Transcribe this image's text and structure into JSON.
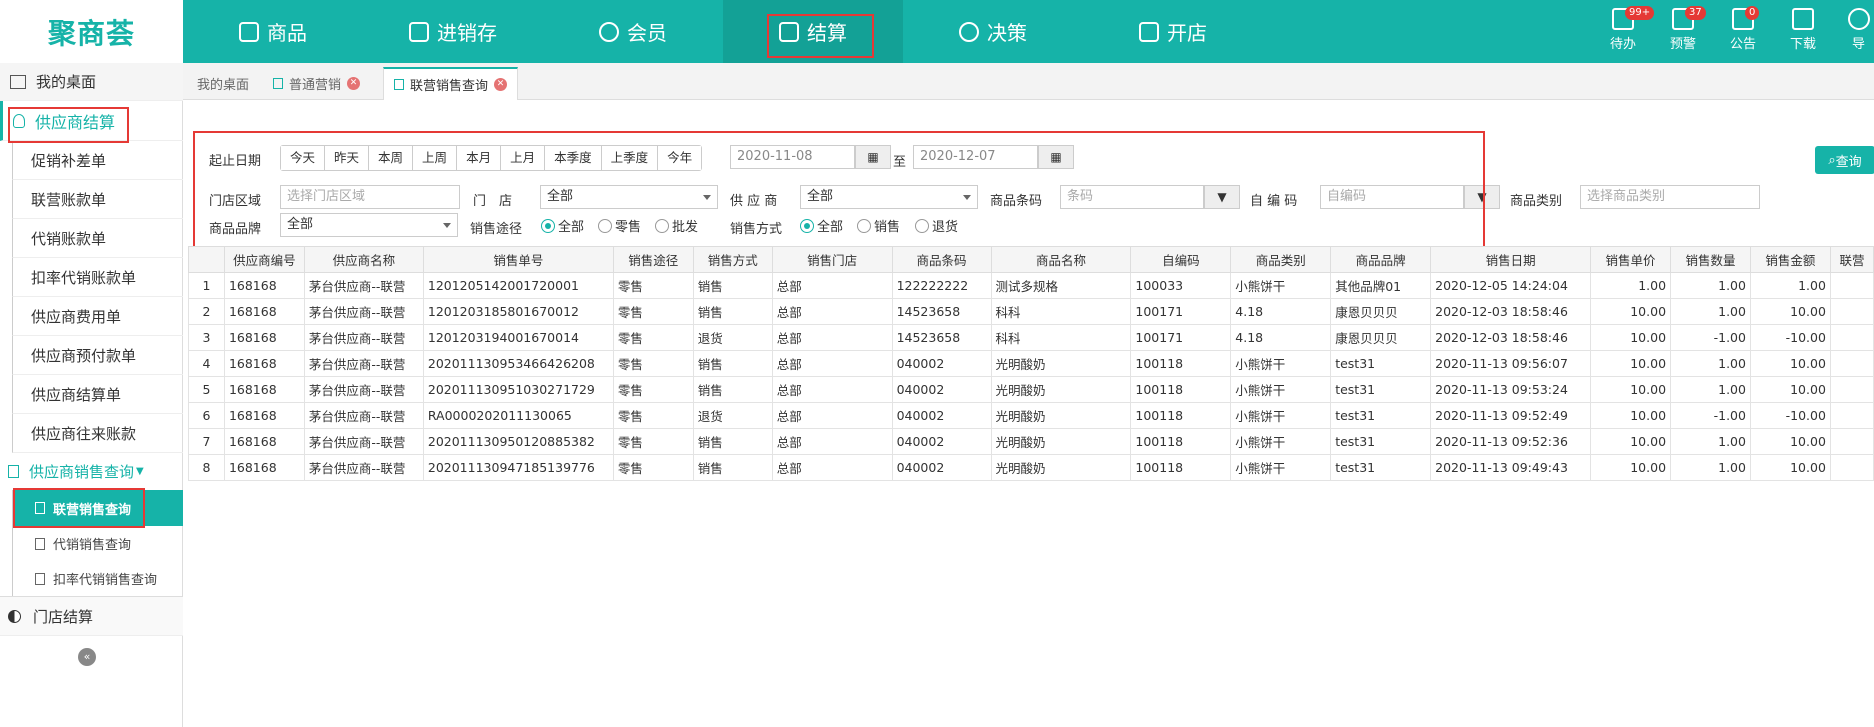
{
  "logo": "聚商荟",
  "nav": [
    "商品",
    "进销存",
    "会员",
    "结算",
    "决策",
    "开店"
  ],
  "top_icons": [
    {
      "label": "待办",
      "badge": "99+",
      "icon": "todo-icon"
    },
    {
      "label": "预警",
      "badge": "37",
      "icon": "warning-icon"
    },
    {
      "label": "公告",
      "badge": "0",
      "icon": "announce-icon"
    },
    {
      "label": "下载",
      "badge": "",
      "icon": "download-icon"
    },
    {
      "label": "导",
      "badge": "",
      "icon": "user-icon"
    }
  ],
  "sidebar": {
    "desk": "我的桌面",
    "supplier": "供应商结算",
    "items": [
      "促销补差单",
      "联营账款单",
      "代销账款单",
      "扣率代销账款单",
      "供应商费用单",
      "供应商预付款单",
      "供应商结算单",
      "供应商往来账款"
    ],
    "sales_query": "供应商销售查询",
    "sub_items": [
      "联营销售查询",
      "代销销售查询",
      "扣率代销销售查询"
    ],
    "store": "门店结算"
  },
  "tabs": [
    "我的桌面",
    "普通营销",
    "联营销售查询"
  ],
  "filter": {
    "date_label": "起止日期",
    "quick_dates": [
      "今天",
      "昨天",
      "本周",
      "上周",
      "本月",
      "上月",
      "本季度",
      "上季度",
      "今年"
    ],
    "date_from": "2020-11-08",
    "to": "至",
    "date_to": "2020-12-07",
    "store_area_label": "门店区域",
    "store_area_ph": "选择门店区域",
    "store_label": "门　店",
    "store_value": "全部",
    "supplier_label": "供 应 商",
    "supplier_value": "全部",
    "barcode_label": "商品条码",
    "barcode_ph": "条码",
    "selfcode_label": "自 编 码",
    "selfcode_ph": "自编码",
    "category_label": "商品类别",
    "category_ph": "选择商品类别",
    "brand_label": "商品品牌",
    "brand_value": "全部",
    "channel_label": "销售途径",
    "channel_opts": [
      "全部",
      "零售",
      "批发"
    ],
    "mode_label": "销售方式",
    "mode_opts": [
      "全部",
      "销售",
      "退货"
    ],
    "query": "查询"
  },
  "table": {
    "headers": [
      "",
      "供应商编号",
      "供应商名称",
      "销售单号",
      "销售途径",
      "销售方式",
      "销售门店",
      "商品条码",
      "商品名称",
      "自编码",
      "商品类别",
      "商品品牌",
      "销售日期",
      "销售单价",
      "销售数量",
      "销售金额",
      "联营"
    ],
    "rows": [
      [
        "1",
        "168168",
        "茅台供应商--联营",
        "1201205142001720001",
        "零售",
        "销售",
        "总部",
        "122222222",
        "测试多规格",
        "100033",
        "小熊饼干",
        "其他品牌01",
        "2020-12-05 14:24:04",
        "1.00",
        "1.00",
        "1.00"
      ],
      [
        "2",
        "168168",
        "茅台供应商--联营",
        "1201203185801670012",
        "零售",
        "销售",
        "总部",
        "14523658",
        "科科",
        "100171",
        "4.18",
        "康恩贝贝贝",
        "2020-12-03 18:58:46",
        "10.00",
        "1.00",
        "10.00"
      ],
      [
        "3",
        "168168",
        "茅台供应商--联营",
        "1201203194001670014",
        "零售",
        "退货",
        "总部",
        "14523658",
        "科科",
        "100171",
        "4.18",
        "康恩贝贝贝",
        "2020-12-03 18:58:46",
        "10.00",
        "-1.00",
        "-10.00"
      ],
      [
        "4",
        "168168",
        "茅台供应商--联营",
        "202011130953466426208",
        "零售",
        "销售",
        "总部",
        "040002",
        "光明酸奶",
        "100118",
        "小熊饼干",
        "test31",
        "2020-11-13 09:56:07",
        "10.00",
        "1.00",
        "10.00"
      ],
      [
        "5",
        "168168",
        "茅台供应商--联营",
        "202011130951030271729",
        "零售",
        "销售",
        "总部",
        "040002",
        "光明酸奶",
        "100118",
        "小熊饼干",
        "test31",
        "2020-11-13 09:53:24",
        "10.00",
        "1.00",
        "10.00"
      ],
      [
        "6",
        "168168",
        "茅台供应商--联营",
        "RA0000202011130065",
        "零售",
        "退货",
        "总部",
        "040002",
        "光明酸奶",
        "100118",
        "小熊饼干",
        "test31",
        "2020-11-13 09:52:49",
        "10.00",
        "-1.00",
        "-10.00"
      ],
      [
        "7",
        "168168",
        "茅台供应商--联营",
        "202011130950120885382",
        "零售",
        "销售",
        "总部",
        "040002",
        "光明酸奶",
        "100118",
        "小熊饼干",
        "test31",
        "2020-11-13 09:52:36",
        "10.00",
        "1.00",
        "10.00"
      ],
      [
        "8",
        "168168",
        "茅台供应商--联营",
        "202011130947185139776",
        "零售",
        "销售",
        "总部",
        "040002",
        "光明酸奶",
        "100118",
        "小熊饼干",
        "test31",
        "2020-11-13 09:49:43",
        "10.00",
        "1.00",
        "10.00"
      ]
    ]
  }
}
